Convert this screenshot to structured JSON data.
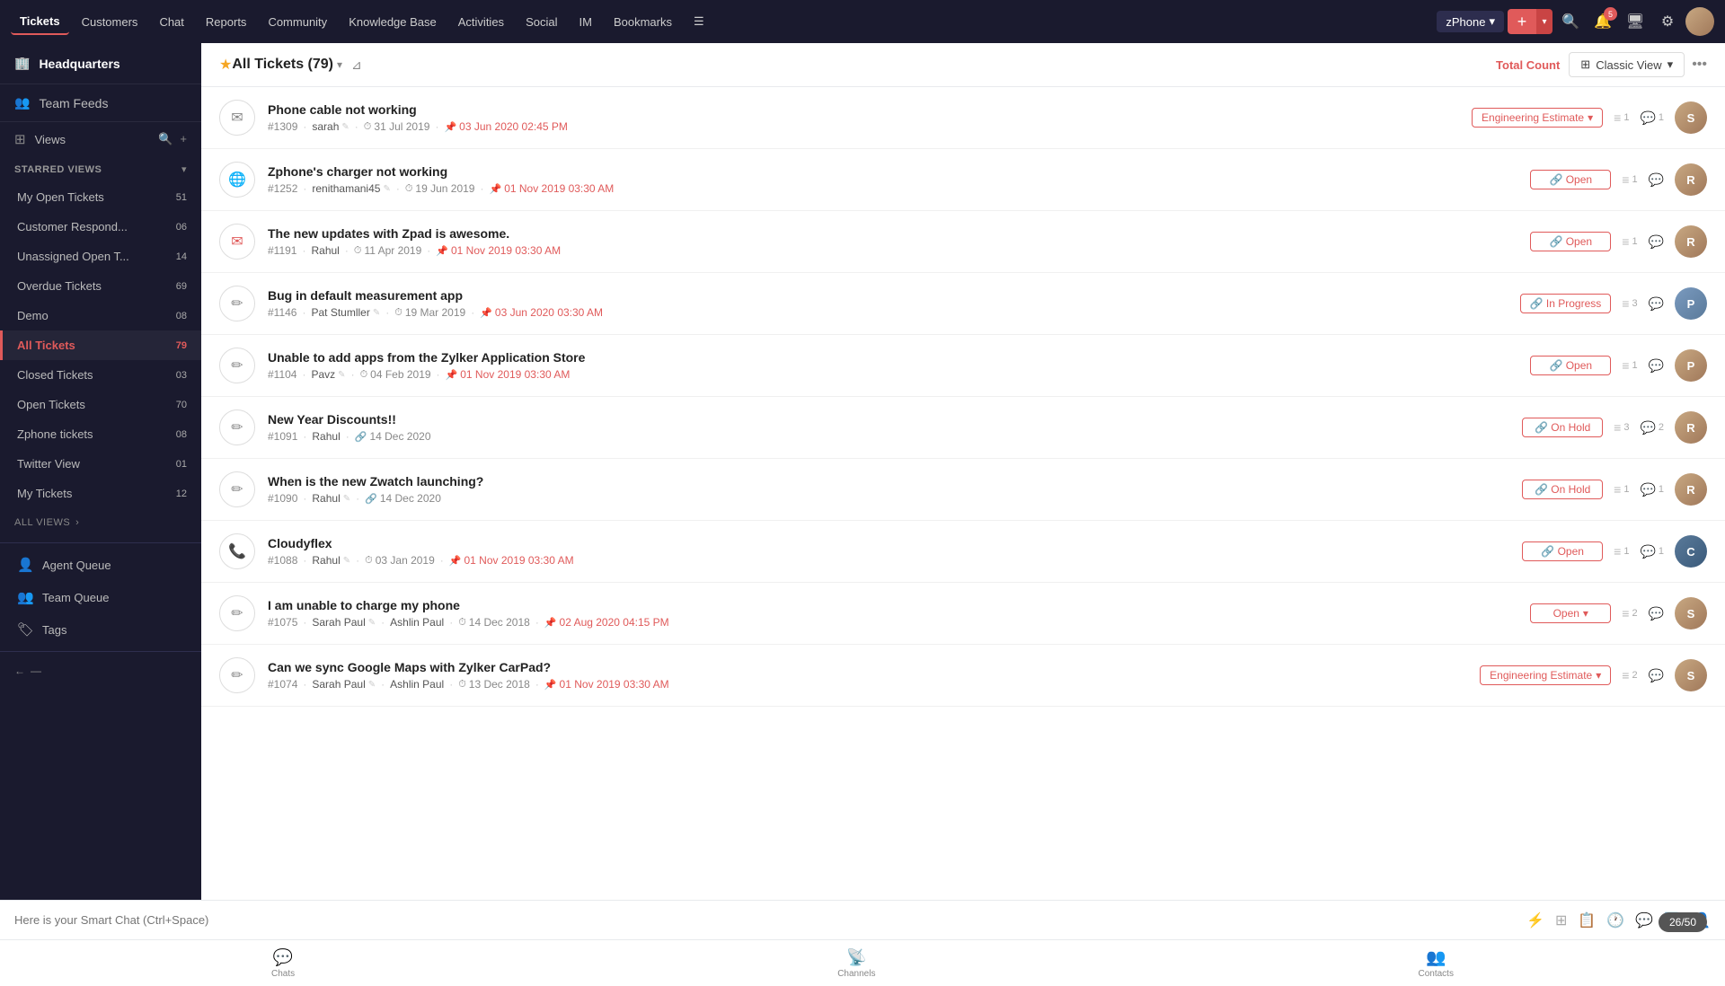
{
  "topnav": {
    "items": [
      {
        "label": "Tickets",
        "active": true
      },
      {
        "label": "Customers"
      },
      {
        "label": "Chat"
      },
      {
        "label": "Reports"
      },
      {
        "label": "Community"
      },
      {
        "label": "Knowledge Base"
      },
      {
        "label": "Activities"
      },
      {
        "label": "Social"
      },
      {
        "label": "IM"
      },
      {
        "label": "Bookmarks"
      }
    ],
    "zphone": "zPhone",
    "notification_count": "5"
  },
  "sidebar": {
    "headquarters": "Headquarters",
    "team_feeds": "Team Feeds",
    "views_label": "Views",
    "starred_views": "STARRED VIEWS",
    "starred_items": [
      {
        "label": "My Open Tickets",
        "count": "51"
      },
      {
        "label": "Customer Respond...",
        "count": "06"
      },
      {
        "label": "Unassigned Open T...",
        "count": "14"
      },
      {
        "label": "Overdue Tickets",
        "count": "69"
      },
      {
        "label": "Demo",
        "count": "08"
      },
      {
        "label": "All Tickets",
        "count": "79",
        "active": true
      },
      {
        "label": "Closed Tickets",
        "count": "03"
      },
      {
        "label": "Open Tickets",
        "count": "70"
      },
      {
        "label": "Zphone tickets",
        "count": "08"
      },
      {
        "label": "Twitter View",
        "count": "01"
      },
      {
        "label": "My Tickets",
        "count": "12"
      }
    ],
    "all_views": "ALL VIEWS",
    "agent_queue": "Agent Queue",
    "team_queue": "Team Queue",
    "tags": "Tags"
  },
  "toolbar": {
    "title": "All Tickets (79)",
    "total_count": "Total Count",
    "classic_view": "Classic View",
    "filter_icon": "⊿"
  },
  "tickets": [
    {
      "id": "#1309",
      "title": "Phone cable not working",
      "agent": "sarah",
      "created": "31 Jul 2019",
      "due": "03 Jun 2020 02:45 PM",
      "status": "Engineering Estimate",
      "status_type": "estimate",
      "comment_count": "1",
      "thread_count": "1",
      "icon": "✉",
      "avatar_color": "#8a6a5e",
      "avatar_letter": "S"
    },
    {
      "id": "#1252",
      "title": "Zphone's charger not working",
      "agent": "renithamani45",
      "created": "19 Jun 2019",
      "due": "01 Nov 2019 03:30 AM",
      "status": "Open",
      "status_type": "open",
      "comment_count": "",
      "thread_count": "1",
      "icon": "🌐",
      "avatar_color": "#8a6a5e",
      "avatar_letter": "R"
    },
    {
      "id": "#1191",
      "title": "The new updates with Zpad is awesome.",
      "agent": "Rahul",
      "created": "11 Apr 2019",
      "due": "01 Nov 2019 03:30 AM",
      "status": "Open",
      "status_type": "open",
      "comment_count": "",
      "thread_count": "1",
      "icon": "✉",
      "avatar_color": "#8a6a5e",
      "avatar_letter": "R"
    },
    {
      "id": "#1146",
      "title": "Bug in default measurement app",
      "agent": "Pat Stumller",
      "created": "19 Mar 2019",
      "due": "03 Jun 2020 03:30 AM",
      "status": "In Progress",
      "status_type": "in-progress",
      "comment_count": "",
      "thread_count": "3",
      "icon": "✏",
      "avatar_color": "#5a7a9a",
      "avatar_letter": "P"
    },
    {
      "id": "#1104",
      "title": "Unable to add apps from the Zylker Application Store",
      "agent": "Pavz",
      "created": "04 Feb 2019",
      "due": "01 Nov 2019 03:30 AM",
      "status": "Open",
      "status_type": "open",
      "comment_count": "",
      "thread_count": "1",
      "icon": "✏",
      "avatar_color": "#8a6a5e",
      "avatar_letter": "P"
    },
    {
      "id": "#1091",
      "title": "New Year Discounts!!",
      "agent": "Rahul",
      "created": "14 Dec 2020",
      "due": "",
      "status": "On Hold",
      "status_type": "on-hold",
      "comment_count": "2",
      "thread_count": "3",
      "icon": "✏",
      "avatar_color": "#8a6a5e",
      "avatar_letter": "R"
    },
    {
      "id": "#1090",
      "title": "When is the new Zwatch launching?",
      "agent": "Rahul",
      "created": "14 Dec 2020",
      "due": "",
      "status": "On Hold",
      "status_type": "on-hold",
      "comment_count": "1",
      "thread_count": "1",
      "icon": "✏",
      "avatar_color": "#8a6a5e",
      "avatar_letter": "R"
    },
    {
      "id": "#1088",
      "title": "Cloudyflex",
      "agent": "Rahul",
      "created": "03 Jan 2019",
      "due": "01 Nov 2019 03:30 AM",
      "status": "Open",
      "status_type": "open",
      "comment_count": "1",
      "thread_count": "1",
      "icon": "📞",
      "avatar_color": "#4a5a7a",
      "avatar_letter": "C"
    },
    {
      "id": "#1075",
      "title": "I am unable to charge my phone",
      "agent": "Sarah Paul",
      "agent2": "Ashlin Paul",
      "created": "14 Dec 2018",
      "due": "02 Aug 2020 04:15 PM",
      "status": "Open",
      "status_type": "open",
      "comment_count": "",
      "thread_count": "2",
      "icon": "✏",
      "avatar_color": "#8a6a5e",
      "avatar_letter": "S"
    },
    {
      "id": "#1074",
      "title": "Can we sync Google Maps with Zylker CarPad?",
      "agent": "Sarah Paul",
      "agent2": "Ashlin Paul",
      "created": "13 Dec 2018",
      "due": "01 Nov 2019 03:30 AM",
      "status": "Engineering Estimate",
      "status_type": "estimate",
      "comment_count": "",
      "thread_count": "2",
      "icon": "✏",
      "avatar_color": "#8a6a5e",
      "avatar_letter": "S"
    }
  ],
  "smart_chat": {
    "placeholder": "Here is your Smart Chat (Ctrl+Space)"
  },
  "pagination": {
    "current": "26/50"
  }
}
